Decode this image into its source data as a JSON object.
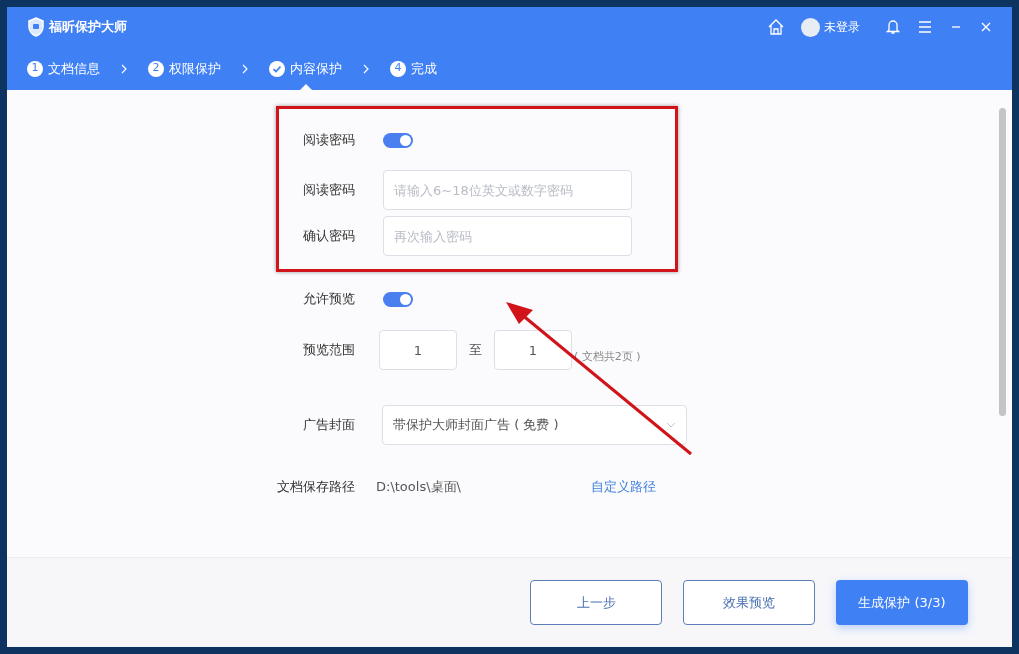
{
  "window": {
    "title": "福昕保护大师",
    "user": "未登录"
  },
  "steps": [
    {
      "number": "1",
      "label": "文档信息",
      "selected": false
    },
    {
      "number": "2",
      "label": "权限保护",
      "selected": false
    },
    {
      "label": "内容保护",
      "selected": true
    },
    {
      "number": "4",
      "label": "完成",
      "selected": false
    }
  ],
  "form": {
    "read_password_toggle": {
      "label": "阅读密码",
      "on": true
    },
    "password": {
      "label": "阅读密码",
      "placeholder": "请输入6~18位英文或数字密码"
    },
    "confirm": {
      "label": "确认密码",
      "placeholder": "再次输入密码"
    },
    "preview_toggle": {
      "label": "允许预览",
      "on": true
    },
    "range": {
      "label": "预览范围",
      "from": "1",
      "separator": "至",
      "to": "1",
      "note": "( 文档共2页 )"
    },
    "cover": {
      "label": "广告封面",
      "value": "带保护大师封面广告 ( 免费 )"
    },
    "path": {
      "label": "文档保存路径",
      "value": "D:\\tools\\桌面\\",
      "link": "自定义路径"
    }
  },
  "buttons": [
    {
      "label": "上一步",
      "kind": "outline"
    },
    {
      "label": "效果预览",
      "kind": "outline"
    },
    {
      "label": "生成保护 (3/3)",
      "kind": "primary"
    }
  ]
}
